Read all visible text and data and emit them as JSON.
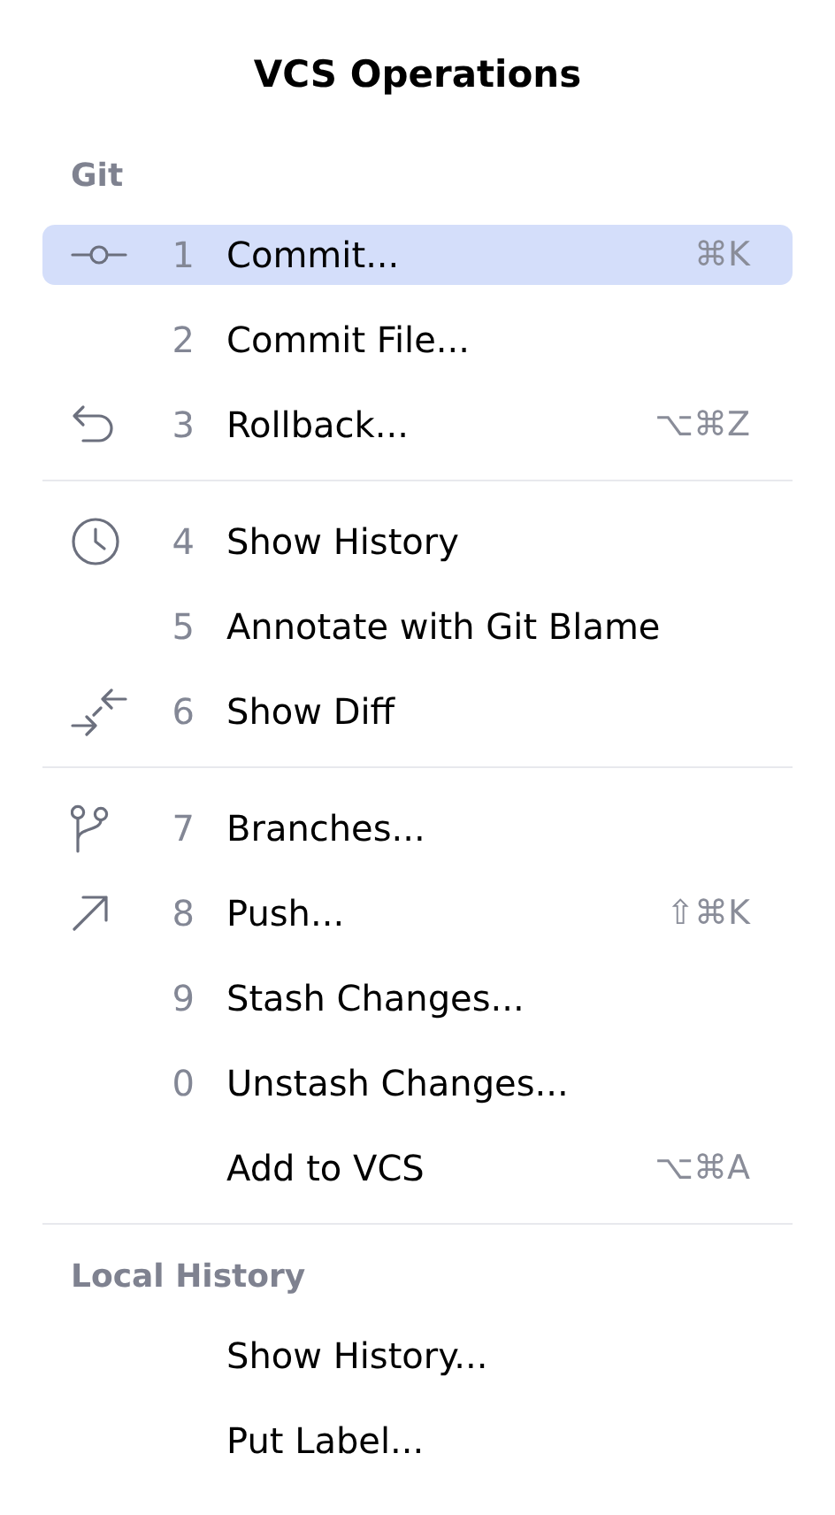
{
  "title": "VCS Operations",
  "sections": [
    {
      "header": "Git",
      "items": [
        {
          "kind": "commit",
          "number": "1",
          "label": "Commit...",
          "shortcut": "⌘K",
          "selected": true
        },
        {
          "kind": "plain",
          "number": "2",
          "label": "Commit File...",
          "selected": false
        },
        {
          "kind": "rollback",
          "number": "3",
          "label": "Rollback...",
          "shortcut": "⌥⌘Z",
          "selected": false
        }
      ]
    },
    {
      "items": [
        {
          "kind": "history",
          "number": "4",
          "label": "Show History",
          "selected": false
        },
        {
          "kind": "plain",
          "number": "5",
          "label": "Annotate with Git Blame",
          "selected": false
        },
        {
          "kind": "diff",
          "number": "6",
          "label": "Show Diff",
          "selected": false
        }
      ]
    },
    {
      "items": [
        {
          "kind": "branch",
          "number": "7",
          "label": "Branches...",
          "selected": false
        },
        {
          "kind": "push",
          "number": "8",
          "label": "Push...",
          "shortcut": "⇧⌘K",
          "selected": false
        },
        {
          "kind": "plain",
          "number": "9",
          "label": "Stash Changes...",
          "selected": false
        },
        {
          "kind": "plain",
          "number": "0",
          "label": "Unstash Changes...",
          "selected": false
        },
        {
          "kind": "plain",
          "label": "Add to VCS",
          "shortcut": "⌥⌘A",
          "selected": false
        }
      ]
    },
    {
      "header": "Local History",
      "items": [
        {
          "kind": "plain",
          "label": "Show History...",
          "selected": false
        },
        {
          "kind": "plain",
          "label": "Put Label...",
          "selected": false
        }
      ]
    }
  ]
}
